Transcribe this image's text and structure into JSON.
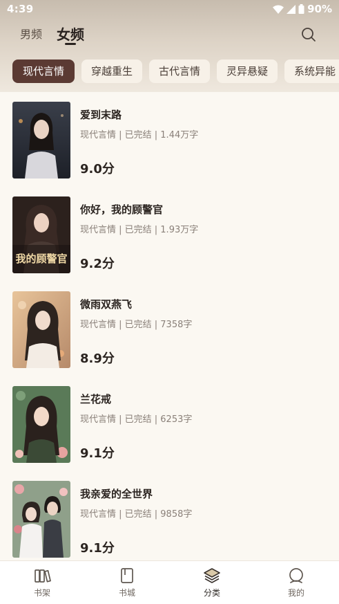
{
  "status": {
    "time": "4:39",
    "battery": "90%"
  },
  "tabs": {
    "male": "男频",
    "female": "女频",
    "active": "female"
  },
  "chips": [
    "现代言情",
    "穿越重生",
    "古代言情",
    "灵异悬疑",
    "系统异能"
  ],
  "books": [
    {
      "title": "爱到末路",
      "meta": "现代言情 | 已完结 | 1.44万字",
      "score": "9.0分"
    },
    {
      "title": "你好，我的顾警官",
      "meta": "现代言情 | 已完结 | 1.93万字",
      "score": "9.2分",
      "cover_text": "我的顾警官"
    },
    {
      "title": "微雨双燕飞",
      "meta": "现代言情 | 已完结 | 7358字",
      "score": "8.9分"
    },
    {
      "title": "兰花戒",
      "meta": "现代言情 | 已完结 | 6253字",
      "score": "9.1分"
    },
    {
      "title": "我亲爱的全世界",
      "meta": "现代言情 | 已完结 | 9858字",
      "score": "9.1分"
    }
  ],
  "nav": [
    {
      "label": "书架",
      "icon": "bookshelf-icon"
    },
    {
      "label": "书城",
      "icon": "book-icon"
    },
    {
      "label": "分类",
      "icon": "layers-icon",
      "active": true
    },
    {
      "label": "我的",
      "icon": "profile-icon"
    }
  ],
  "colors": {
    "accent": "#5b3a33",
    "background": "#fbf8f2"
  }
}
